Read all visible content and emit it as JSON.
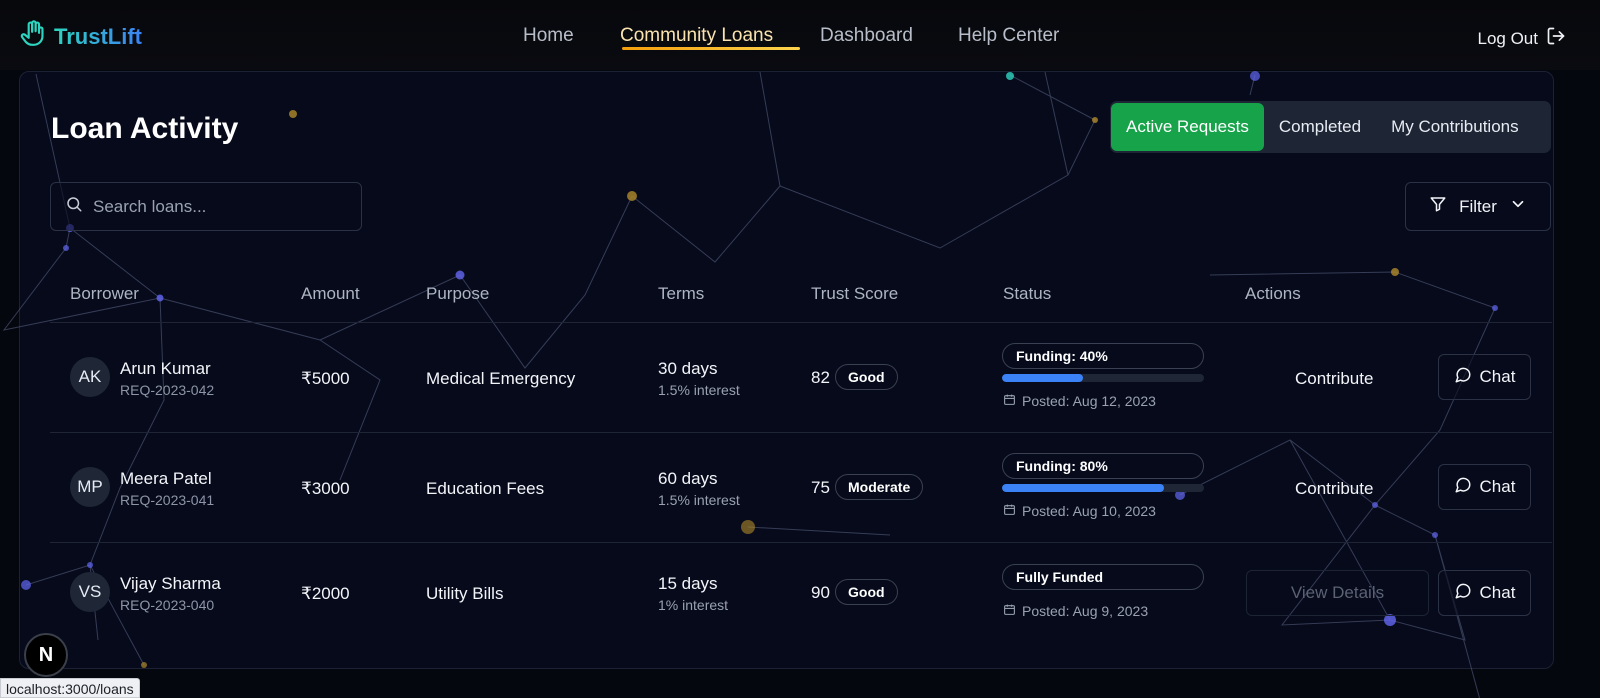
{
  "app": {
    "name": "TrustLift"
  },
  "nav": {
    "links": [
      {
        "label": "Home",
        "active": false
      },
      {
        "label": "Community Loans",
        "active": true
      },
      {
        "label": "Dashboard",
        "active": false
      },
      {
        "label": "Help Center",
        "active": false
      }
    ],
    "logout_label": "Log Out"
  },
  "page": {
    "title": "Loan Activity",
    "tabs": [
      {
        "label": "Active Requests",
        "active": true
      },
      {
        "label": "Completed",
        "active": false
      },
      {
        "label": "My Contributions",
        "active": false
      }
    ],
    "search_placeholder": "Search loans...",
    "filter_label": "Filter"
  },
  "table": {
    "columns": [
      "Borrower",
      "Amount",
      "Purpose",
      "Terms",
      "Trust Score",
      "Status",
      "Actions"
    ],
    "rows": [
      {
        "initials": "AK",
        "name": "Arun Kumar",
        "request_id": "REQ-2023-042",
        "amount": "₹5000",
        "purpose": "Medical Emergency",
        "term": "30 days",
        "interest": "1.5% interest",
        "trust_score": "82",
        "trust_label": "Good",
        "status": "Funding: 40%",
        "funding_progress": 0.4,
        "posted": "Posted: Aug 12, 2023",
        "action": "Contribute",
        "chat_label": "Chat"
      },
      {
        "initials": "MP",
        "name": "Meera Patel",
        "request_id": "REQ-2023-041",
        "amount": "₹3000",
        "purpose": "Education Fees",
        "term": "60 days",
        "interest": "1.5% interest",
        "trust_score": "75",
        "trust_label": "Moderate",
        "status": "Funding: 80%",
        "funding_progress": 0.8,
        "posted": "Posted: Aug 10, 2023",
        "action": "Contribute",
        "chat_label": "Chat"
      },
      {
        "initials": "VS",
        "name": "Vijay Sharma",
        "request_id": "REQ-2023-040",
        "amount": "₹2000",
        "purpose": "Utility Bills",
        "term": "15 days",
        "interest": "1% interest",
        "trust_score": "90",
        "trust_label": "Good",
        "status": "Fully Funded",
        "posted": "Posted: Aug 9, 2023",
        "action": "View Details",
        "chat_label": "Chat"
      }
    ]
  },
  "dev_indicator": "N",
  "status_bar_url": "localhost:3000/loans",
  "colors": {
    "accent_green": "#16a34a",
    "progress_blue": "#3b82f6",
    "nav_active": "#f59e0b",
    "background": "#060a1b"
  },
  "icons": [
    "hand-logo-icon",
    "logout-icon",
    "search-icon",
    "filter-icon",
    "chevron-down-icon",
    "calendar-icon",
    "chat-icon"
  ]
}
